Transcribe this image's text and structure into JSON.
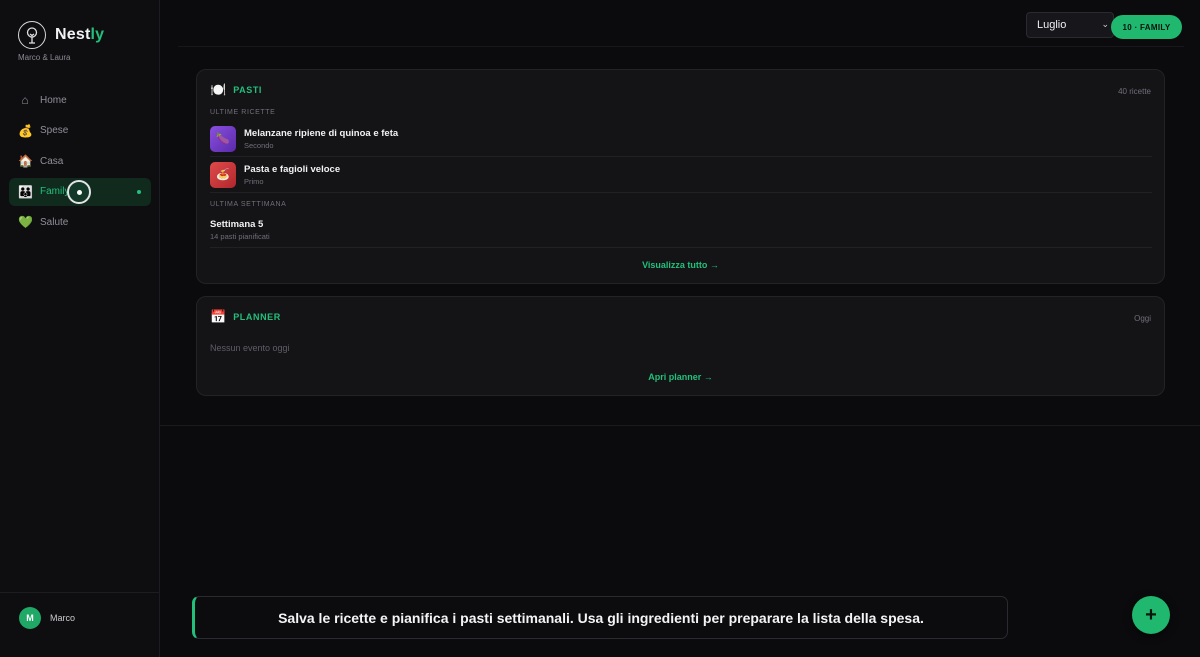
{
  "brand": {
    "name_main": "Nest",
    "name_accent": "ly",
    "subtitle": "Marco & Laura"
  },
  "sidebar": {
    "items": [
      {
        "label": "Home",
        "icon": "⌂"
      },
      {
        "label": "Spese",
        "icon": "💰"
      },
      {
        "label": "Casa",
        "icon": "🏠"
      },
      {
        "label": "Family",
        "icon": "👪"
      },
      {
        "label": "Salute",
        "icon": "💚"
      }
    ],
    "active": "Family",
    "user": {
      "initial": "M",
      "name": "Marco"
    }
  },
  "topbar": {
    "month": "Luglio",
    "badge": "10 · FAMILY"
  },
  "pasti": {
    "icon": "🍽️",
    "title": "PASTI",
    "count": "40 ricette",
    "recent_label": "ULTIME RICETTE",
    "recipes": [
      {
        "title": "Melanzane ripiene di quinoa e feta",
        "category": "Secondo",
        "thumb_icon": "🍆"
      },
      {
        "title": "Pasta e fagioli veloce",
        "category": "Primo",
        "thumb_icon": "🍝"
      }
    ],
    "week_label": "ULTIMA SETTIMANA",
    "week": {
      "title": "Settimana 5",
      "subtitle": "14 pasti pianificati"
    },
    "link": "Visualizza tutto →"
  },
  "planner": {
    "icon": "📅",
    "title": "PLANNER",
    "meta": "Oggi",
    "empty": "Nessun evento oggi",
    "link": "Apri planner →"
  },
  "toast": {
    "message": "Salva le ricette e pianifica i pasti settimanali. Usa gli ingredienti per preparare la lista della spesa."
  },
  "fab": {
    "label": "+"
  },
  "colors": {
    "accent": "#22c07a",
    "background": "#0b0b0d",
    "card": "#141417"
  }
}
